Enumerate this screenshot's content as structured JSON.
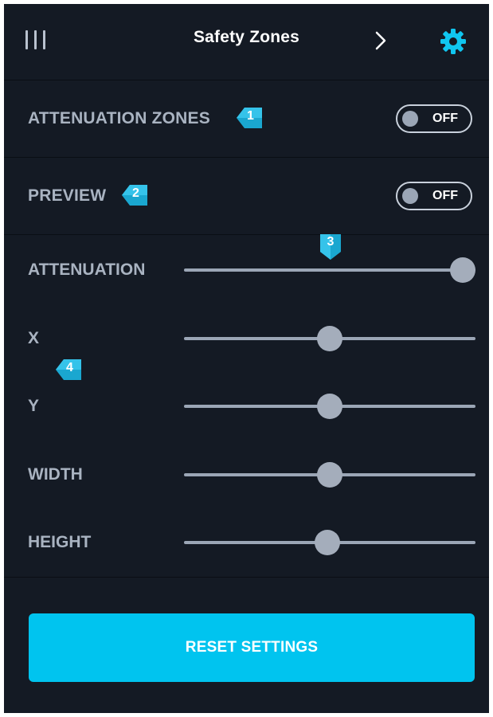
{
  "header": {
    "title": "Safety Zones",
    "menu_icon": "menu-bars-icon",
    "next_icon": "chevron-right-icon",
    "settings_icon": "gear-icon"
  },
  "toggles": [
    {
      "label": "ATTENUATION ZONES",
      "state": "OFF",
      "marker": "1"
    },
    {
      "label": "PREVIEW",
      "state": "OFF",
      "marker": "2"
    }
  ],
  "markers": {
    "three": "3",
    "four": "4"
  },
  "sliders": [
    {
      "label": "ATTENUATION",
      "value": 1.0
    },
    {
      "label": "X",
      "value": 0.5
    },
    {
      "label": "Y",
      "value": 0.5
    },
    {
      "label": "WIDTH",
      "value": 0.5
    },
    {
      "label": "HEIGHT",
      "value": 0.49
    }
  ],
  "reset_button": {
    "label": "RESET SETTINGS"
  },
  "colors": {
    "background": "#141a24",
    "accent": "#00c4ef",
    "slider": "#9ba6b6"
  }
}
